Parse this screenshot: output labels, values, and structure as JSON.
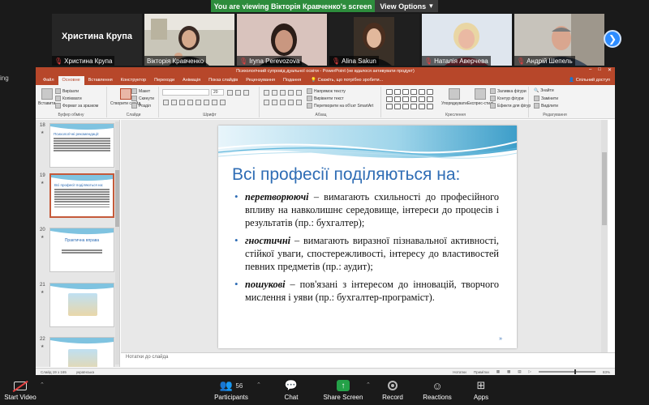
{
  "zoom": {
    "banner": {
      "viewing_text": "You are viewing Вікторія Кравченко's screen",
      "view_options_label": "View Options"
    },
    "left_clip_text": "ing",
    "participants": [
      {
        "name": "Христина Крупа",
        "big_name": "Христина Крупа",
        "muted": true,
        "active": false,
        "video": false
      },
      {
        "name": "Вікторія Кравченко",
        "muted": false,
        "active": true,
        "video": true
      },
      {
        "name": "Iryna Perevozova",
        "display": "Iryna Perevozova",
        "muted": true,
        "active": false,
        "video": true
      },
      {
        "name": "Alina Sakun",
        "muted": true,
        "active": false,
        "video": true
      },
      {
        "name": "Наталія Аверчева",
        "muted": true,
        "active": false,
        "video": true
      },
      {
        "name": "Андрій Шепель",
        "muted": true,
        "active": false,
        "video": true
      }
    ],
    "toolbar": {
      "start_video": "Start Video",
      "participants": "Participants",
      "participants_count": "56",
      "chat": "Chat",
      "share_screen": "Share Screen",
      "record": "Record",
      "reactions": "Reactions",
      "apps": "Apps"
    }
  },
  "ppt": {
    "window_title": "Психологічний супровід дуальної освіти - PowerPoint (не вдалося активувати продукт)",
    "tabs": [
      "Файл",
      "Основне",
      "Вставлення",
      "Конструктор",
      "Переходи",
      "Анімація",
      "Показ слайдів",
      "Рецензування",
      "Подання"
    ],
    "active_tab": "Основне",
    "tell_me": "Скажіть, що потрібно зробити...",
    "share_label": "Спільний доступ",
    "ribbon": {
      "paste": "Вставити",
      "cut": "Вирізати",
      "copy": "Копіювати",
      "format_painter": "Формат за зразком",
      "clipboard_group": "Буфер обміну",
      "new_slide": "Створити слайд",
      "layout": "Макет",
      "reset": "Скинути",
      "section": "Розділ",
      "slides_group": "Слайди",
      "font_size": "20",
      "font_group": "Шрифт",
      "text_direction": "Напрямок тексту",
      "align_text": "Вирівняти текст",
      "convert_smartart": "Перетворити на об'єкт SmartArt",
      "paragraph_group": "Абзац",
      "arrange": "Упорядкувати",
      "quick_styles": "Експрес-стилі",
      "shape_fill": "Заливка фігури",
      "shape_outline": "Контур фігури",
      "shape_effects": "Ефекти для фігур",
      "drawing_group": "Креслення",
      "find": "Знайти",
      "replace": "Замінити",
      "select": "Виділити",
      "editing_group": "Редагування"
    },
    "thumbnails": [
      {
        "number": "18",
        "title": "Психологічні рекомендації:"
      },
      {
        "number": "19",
        "title": "Всі професії поділяються на:"
      },
      {
        "number": "20",
        "title": "Практична вправа"
      },
      {
        "number": "21",
        "title": ""
      },
      {
        "number": "22",
        "title": ""
      }
    ],
    "slide": {
      "title": "Всі професії поділяються на:",
      "bullets": [
        {
          "term": "перетворюючі",
          "text": " – вимагають схильності до професійного впливу на навколишнє середовище, інтереси до процесів і результатів (пр.: бухгалтер);"
        },
        {
          "term": "гностичні",
          "text": " – вимагають виразної пізнавальної активності, стійкої уваги, спостережливості, інтересу до властивостей певних предметів (пр.: аудит);"
        },
        {
          "term": "пошукові",
          "text": " – пов'язані з інтересом до інновацій, творчого мислення і уяви (пр.: бухгалтер-програміст)."
        }
      ]
    },
    "notes_placeholder": "Нотатки до слайда",
    "status": {
      "slide_counter": "Слайд 19 з 165",
      "language": "українська",
      "notes": "Нотатки",
      "comments": "Примітки",
      "zoom": "83%"
    }
  },
  "colors": {
    "ppt_accent": "#b7472a",
    "slide_title_blue": "#2f6db5",
    "zoom_green": "#2d8c3c",
    "zoom_blue": "#2d8cff"
  }
}
